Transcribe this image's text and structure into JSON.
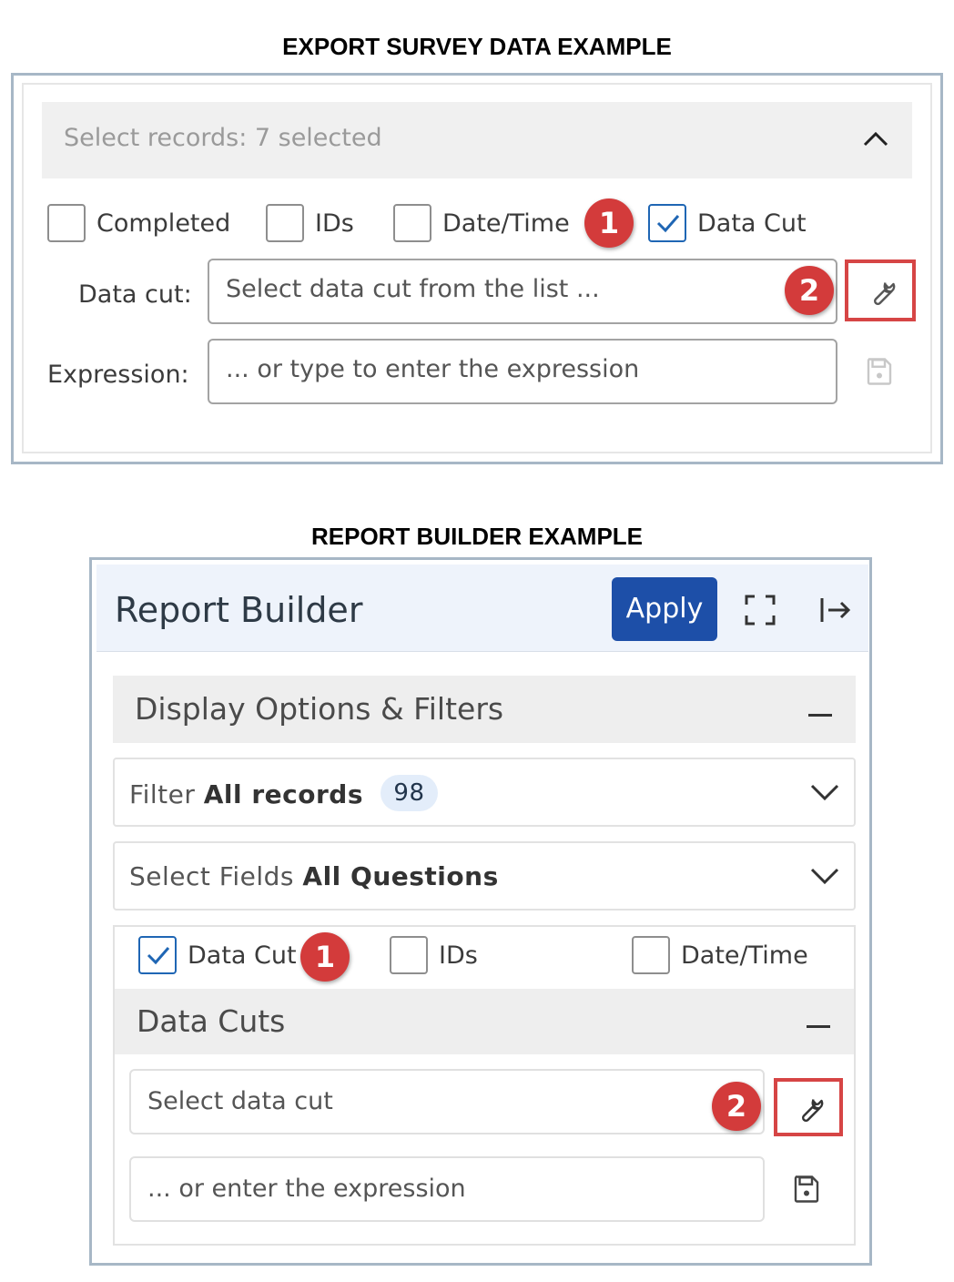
{
  "export_section": {
    "title": "EXPORT SURVEY DATA EXAMPLE",
    "records_header": "Select records: 7 selected",
    "checkboxes": [
      {
        "label": "Completed",
        "checked": false
      },
      {
        "label": "IDs",
        "checked": false
      },
      {
        "label": "Date/Time",
        "checked": false
      },
      {
        "label": "Data Cut",
        "checked": true
      }
    ],
    "badge_1": "1",
    "badge_2": "2",
    "data_cut_label": "Data cut:",
    "data_cut_placeholder": "Select data cut from the list ...",
    "expression_label": "Expression:",
    "expression_placeholder": "... or type to enter the expression",
    "highlight_color": "#d64545",
    "badge_color": "#d33b3b"
  },
  "report_section": {
    "title": "REPORT BUILDER EXAMPLE",
    "panel_title": "Report Builder",
    "apply_label": "Apply",
    "apply_color": "#1d4fa8",
    "display_options_title": "Display Options & Filters",
    "filter": {
      "key": "Filter",
      "value": "All records",
      "count": "98"
    },
    "select_fields": {
      "key": "Select Fields",
      "value": "All Questions"
    },
    "checkboxes": [
      {
        "label": "Data Cut",
        "checked": true
      },
      {
        "label": "IDs",
        "checked": false
      },
      {
        "label": "Date/Time",
        "checked": false
      }
    ],
    "badge_1": "1",
    "badge_2": "2",
    "data_cuts_title": "Data Cuts",
    "data_cut_placeholder": "Select data cut",
    "expression_placeholder": "... or enter the expression"
  }
}
